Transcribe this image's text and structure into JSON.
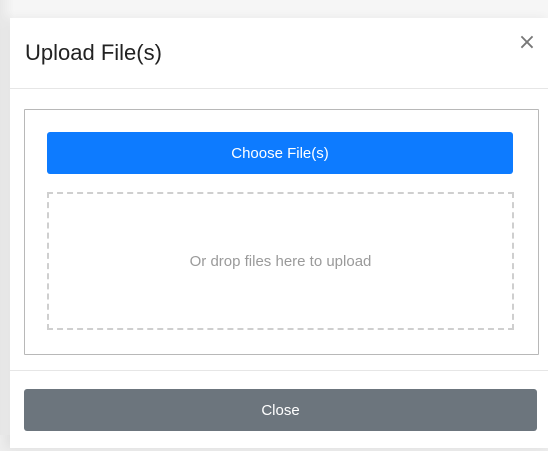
{
  "modal": {
    "title": "Upload File(s)",
    "close_icon": "×",
    "choose_button_label": "Choose File(s)",
    "drop_zone_text": "Or drop files here to upload",
    "footer_close_label": "Close"
  },
  "colors": {
    "primary_button": "#0d7bff",
    "secondary_button": "#6c757d"
  }
}
